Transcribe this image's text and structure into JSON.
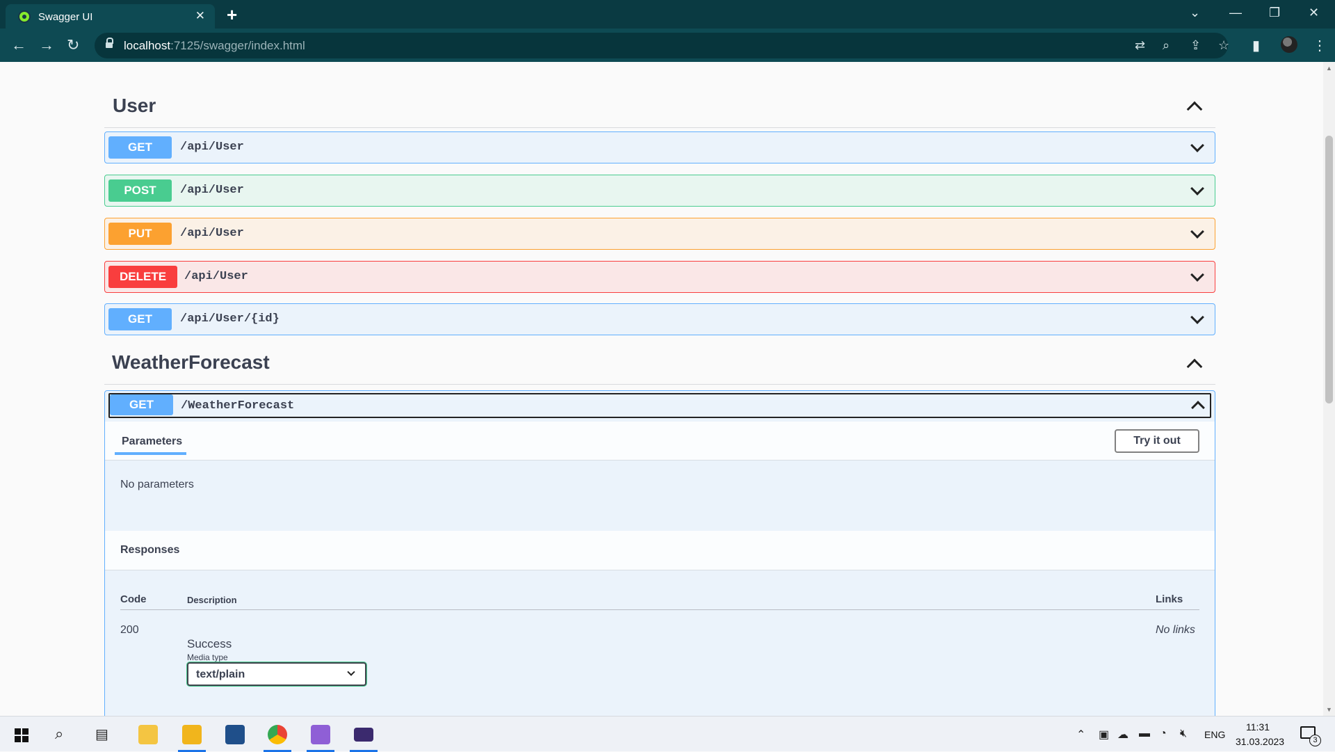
{
  "browser": {
    "tab_title": "Swagger UI",
    "url_host": "localhost",
    "url_rest": ":7125/swagger/index.html"
  },
  "sections": [
    {
      "title": "User",
      "endpoints": [
        {
          "method": "GET",
          "path": "/api/User"
        },
        {
          "method": "POST",
          "path": "/api/User"
        },
        {
          "method": "PUT",
          "path": "/api/User"
        },
        {
          "method": "DELETE",
          "path": "/api/User"
        },
        {
          "method": "GET",
          "path": "/api/User/{id}"
        }
      ]
    },
    {
      "title": "WeatherForecast",
      "endpoints": [
        {
          "method": "GET",
          "path": "/WeatherForecast",
          "expanded": true
        }
      ]
    }
  ],
  "expanded_op": {
    "parameters_tab": "Parameters",
    "try_button": "Try it out",
    "no_params": "No parameters",
    "responses_title": "Responses",
    "columns": {
      "code": "Code",
      "description": "Description",
      "links": "Links"
    },
    "response": {
      "code": "200",
      "description": "Success",
      "links": "No links"
    },
    "media_type_label": "Media type",
    "media_type_value": "text/plain"
  },
  "taskbar": {
    "language": "ENG",
    "time": "11:31",
    "date": "31.03.2023",
    "notification_count": "3"
  },
  "colors": {
    "get": "#61affe",
    "post": "#49cc90",
    "put": "#fca130",
    "delete": "#f93e3e",
    "chrome_dark": "#0a3a42",
    "chrome_toolbar": "#0e4a53"
  }
}
